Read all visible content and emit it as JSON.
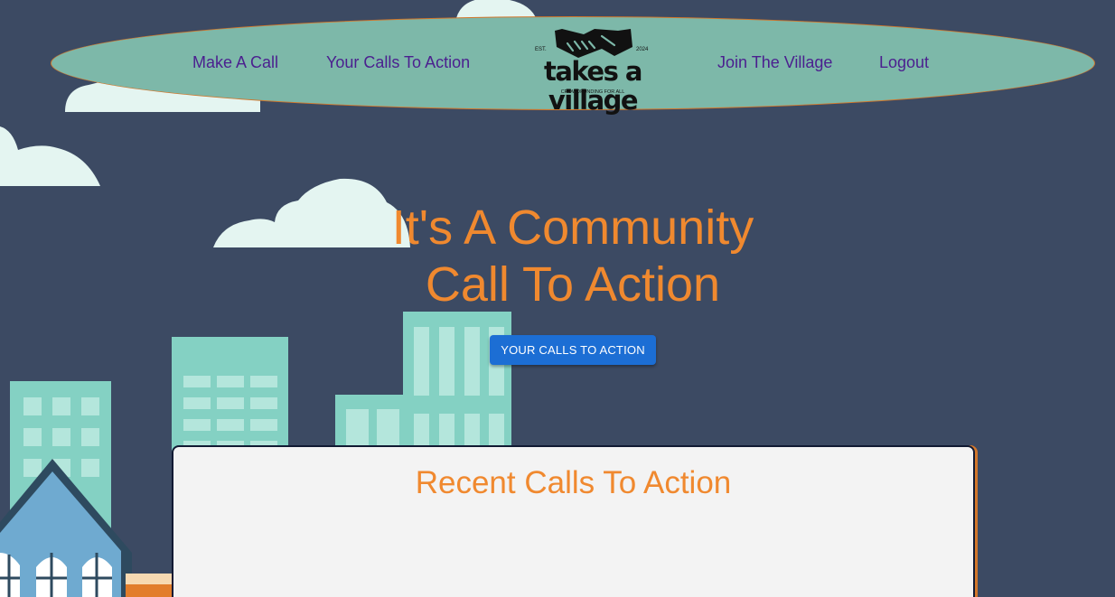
{
  "nav": {
    "make_call": "Make A Call",
    "your_calls": "Your Calls To Action",
    "join_village": "Join The Village",
    "logout": "Logout"
  },
  "logo": {
    "est": "EST.",
    "year": "2024",
    "wordmark": "takes a village",
    "tagline": "CROWDFUNDING FOR ALL",
    "icon": "handshake-icon"
  },
  "hero": {
    "title_line1": "It's A Community",
    "title_line2": "Call To Action",
    "button_label": "YOUR CALLS TO ACTION"
  },
  "recent": {
    "title": "Recent Calls To Action"
  },
  "colors": {
    "background": "#3c4a63",
    "nav_fill": "#7db8a9",
    "accent_orange": "#f0892f",
    "nav_link": "#4b1f8f",
    "button_blue": "#1c6ed4",
    "panel_bg": "#f3f3f3",
    "cloud": "#e4f5f1",
    "building": "#84d1c3"
  }
}
